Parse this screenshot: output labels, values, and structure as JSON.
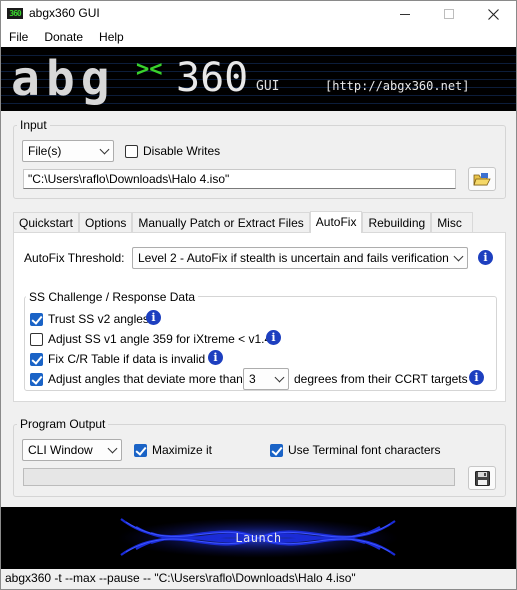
{
  "window": {
    "title": "abgx360 GUI",
    "icon_text": "360"
  },
  "menu": [
    "File",
    "Donate",
    "Help"
  ],
  "banner": {
    "gui_label": "GUI",
    "url": "[http://abgx360.net]"
  },
  "input": {
    "group_label": "Input",
    "source_select": "File(s)",
    "disable_writes_label": "Disable Writes",
    "disable_writes_checked": false,
    "path_value": "\"C:\\Users\\raflo\\Downloads\\Halo 4.iso\"",
    "browse_icon": "folder-open-icon"
  },
  "tabs": [
    {
      "label": "Quickstart",
      "active": false
    },
    {
      "label": "Options",
      "active": false
    },
    {
      "label": "Manually Patch or Extract Files",
      "active": false
    },
    {
      "label": "AutoFix",
      "active": true
    },
    {
      "label": "Rebuilding",
      "active": false
    },
    {
      "label": "Misc",
      "active": false
    }
  ],
  "autofix": {
    "threshold_label": "AutoFix Threshold:",
    "threshold_value": "Level 2 - AutoFix if stealth is uncertain and fails verification",
    "ss_group_label": "SS Challenge / Response Data",
    "options": [
      {
        "label": "Trust SS v2 angles",
        "checked": true
      },
      {
        "label": "Adjust SS v1 angle 359 for iXtreme < v1.4",
        "checked": false
      },
      {
        "label": "Fix C/R Table if data is invalid",
        "checked": true
      },
      {
        "label": "Adjust angles that deviate more than",
        "checked": true
      }
    ],
    "deviation_value": "3",
    "deviation_suffix": "degrees from their CCRT targets"
  },
  "program_output": {
    "group_label": "Program Output",
    "output_select": "CLI Window",
    "maximize_label": "Maximize it",
    "maximize_checked": true,
    "terminal_font_label": "Use Terminal font characters",
    "terminal_font_checked": true,
    "save_icon": "floppy-disk-icon",
    "progress": 0
  },
  "launch": {
    "label": "Launch"
  },
  "status": {
    "command": "abgx360 -t --max --pause -- \"C:\\Users\\raflo\\Downloads\\Halo 4.iso\""
  },
  "colors": {
    "accent": "#1a63c6",
    "info": "#1d3fbf",
    "logo_green": "#39d12c",
    "launch_glow": "#1a2bd6"
  }
}
